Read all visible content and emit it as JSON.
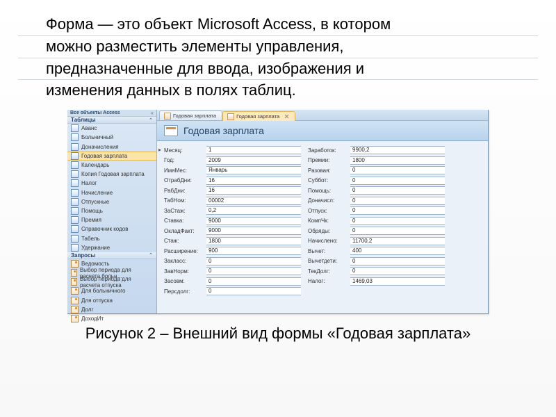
{
  "paragraph_lines": [
    "Форма — это объект Microsoft Access, в котором",
    "можно    разместить    элементы    управления,",
    "предназначенные  для  ввода,  изображения  и",
    "изменения данных в полях таблиц."
  ],
  "caption": "Рисунок 2 – Внешний вид формы «Годовая зарплата»",
  "sidebar": {
    "header": "Все объекты Access",
    "cat_tables": "Таблицы",
    "cat_queries": "Запросы",
    "tables": [
      "Аванс",
      "Больничный",
      "Доначисления",
      "Годовая зарплата",
      "Календарь",
      "Копия Годовая зарплата",
      "Налог",
      "Начисление",
      "Отпускные",
      "Помощь",
      "Премия",
      "Справочник кодов",
      "Табель",
      "Удержание"
    ],
    "queries": [
      "Ведомость",
      "Выбор периода для расчета больн…",
      "Выбор периода для расчета отпуска",
      "Для больничного",
      "Для отпуска",
      "Долг",
      "ДоходИт"
    ]
  },
  "tabs": [
    {
      "label": "Годовая зарплата",
      "active": false
    },
    {
      "label": "Годовая зарплата",
      "active": true
    }
  ],
  "form_title": "Годовая зарплата",
  "form_rows": [
    {
      "l1": "Месяц:",
      "v1": "1",
      "l2": "Заработок:",
      "v2": "9900,2"
    },
    {
      "l1": "Год:",
      "v1": "2009",
      "l2": "Премии:",
      "v2": "1800"
    },
    {
      "l1": "ИмяМес:",
      "v1": "Январь",
      "l2": "Разовая:",
      "v2": "0"
    },
    {
      "l1": "ОтрабДни:",
      "v1": "16",
      "l2": "Суббот:",
      "v2": "0"
    },
    {
      "l1": "РабДни:",
      "v1": "16",
      "l2": "Помощь:",
      "v2": "0"
    },
    {
      "l1": "ТабНом:",
      "v1": "00002",
      "l2": "Доначисл:",
      "v2": "0"
    },
    {
      "l1": "ЗаСтаж:",
      "v1": "0,2",
      "l2": "Отпуск:",
      "v2": "0"
    },
    {
      "l1": "Ставка:",
      "v1": "9000",
      "l2": "КомпЧк:",
      "v2": "0"
    },
    {
      "l1": "ОкладФакт:",
      "v1": "9000",
      "l2": "Обряды:",
      "v2": "0"
    },
    {
      "l1": "Стаж:",
      "v1": "1800",
      "l2": "Начислено:",
      "v2": "11700,2"
    },
    {
      "l1": "Расширение:",
      "v1": "900",
      "l2": "Вычет:",
      "v2": "400"
    },
    {
      "l1": "Закласс:",
      "v1": "0",
      "l2": "Вычетдети:",
      "v2": "0"
    },
    {
      "l1": "ЗавНорм:",
      "v1": "0",
      "l2": "ТекДолг:",
      "v2": "0"
    },
    {
      "l1": "Засовм:",
      "v1": "0",
      "l2": "Налог:",
      "v2": "1469,03"
    },
    {
      "l1": "Персдолг:",
      "v1": "0",
      "l2": "",
      "v2": ""
    }
  ]
}
